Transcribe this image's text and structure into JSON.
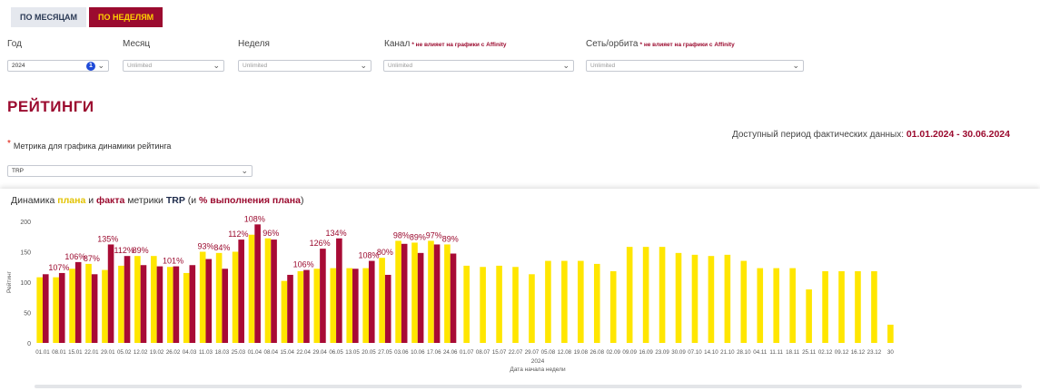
{
  "tabs": {
    "months": "ПО МЕСЯЦАМ",
    "weeks": "ПО НЕДЕЛЯМ"
  },
  "filters": {
    "year": {
      "label": "Год",
      "value": "2024",
      "badge": "1"
    },
    "month": {
      "label": "Месяц",
      "value": "Unlimited"
    },
    "week": {
      "label": "Неделя",
      "value": "Unlimited"
    },
    "channel": {
      "label": "Канал",
      "note": "* не влияет на графики с Affinity",
      "value": "Unlimited"
    },
    "network": {
      "label": "Сеть/орбита",
      "note": "* не влияет на графики с Affinity",
      "value": "Unlimited"
    }
  },
  "section_title": "РЕЙТИНГИ",
  "period": {
    "label": "Доступный период фактических данных:",
    "start": "01.01.2024",
    "sep": "-",
    "end": "30.06.2024"
  },
  "metric": {
    "star": "*",
    "label": "Метрика для графика динамики рейтинга",
    "value": "TRP"
  },
  "chart_title": {
    "t1": "Динамика ",
    "plan": "плана",
    "t2": " и ",
    "fact": "факта",
    "t3": " метрики ",
    "metric": "TRP",
    "t4": " (и ",
    "pct": "% выполнения плана",
    "t5": ")"
  },
  "colors": {
    "plan": "#ffe600",
    "fact": "#a80b35",
    "accent": "#9b0b2f"
  },
  "chart_data": {
    "type": "bar",
    "ylabel": "Рейтинг",
    "xlabel": "Дата начала недели",
    "xsublabel": "2024",
    "ylim": [
      0,
      200
    ],
    "yticks": [
      0,
      50,
      100,
      150,
      200
    ],
    "categories": [
      "01.01",
      "08.01",
      "15.01",
      "22.01",
      "29.01",
      "05.02",
      "12.02",
      "19.02",
      "26.02",
      "04.03",
      "11.03",
      "18.03",
      "25.03",
      "01.04",
      "08.04",
      "15.04",
      "22.04",
      "29.04",
      "06.05",
      "13.05",
      "20.05",
      "27.05",
      "03.06",
      "10.06",
      "17.06",
      "24.06",
      "01.07",
      "08.07",
      "15.07",
      "22.07",
      "29.07",
      "05.08",
      "12.08",
      "19.08",
      "26.08",
      "02.09",
      "09.09",
      "16.09",
      "23.09",
      "30.09",
      "07.10",
      "14.10",
      "21.10",
      "28.10",
      "04.11",
      "11.11",
      "18.11",
      "25.11",
      "02.12",
      "09.12",
      "16.12",
      "23.12",
      "30"
    ],
    "series": [
      {
        "name": "плана",
        "values": [
          108,
          108,
          122,
          130,
          120,
          127,
          143,
          143,
          125,
          115,
          150,
          148,
          150,
          178,
          172,
          102,
          118,
          122,
          123,
          123,
          123,
          140,
          168,
          165,
          168,
          162,
          127,
          125,
          127,
          125,
          113,
          135,
          135,
          135,
          130,
          118,
          158,
          158,
          158,
          148,
          145,
          143,
          145,
          135,
          123,
          123,
          123,
          88,
          118,
          118,
          118,
          118,
          30
        ]
      },
      {
        "name": "факта",
        "values": [
          113,
          115,
          133,
          113,
          162,
          143,
          128,
          126,
          126,
          128,
          138,
          122,
          170,
          195,
          170,
          112,
          120,
          155,
          172,
          122,
          135,
          112,
          163,
          148,
          162,
          147
        ]
      }
    ],
    "labels": [
      "",
      "107%",
      "106%",
      "87%",
      "135%",
      "112%",
      "89%",
      "",
      "101%",
      "",
      "93%",
      "84%",
      "112%",
      "108%",
      "96%",
      "",
      "106%",
      "126%",
      "134%",
      "",
      "108%",
      "80%",
      "98%",
      "89%",
      "97%",
      "89%"
    ]
  }
}
